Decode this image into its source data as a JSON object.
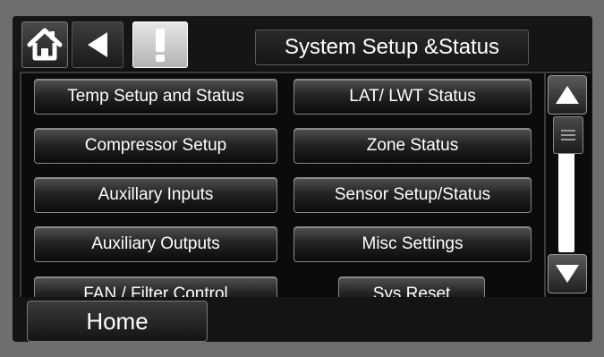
{
  "header": {
    "title": "System Setup &Status",
    "icons": [
      "home-icon",
      "back-arrow-icon",
      "alert-icon"
    ]
  },
  "menu": {
    "left": [
      "Temp Setup and Status",
      "Compressor Setup",
      "Auxillary Inputs",
      "Auxiliary Outputs",
      "FAN / Filter Control"
    ],
    "right": [
      "LAT/ LWT Status",
      "Zone Status",
      "Sensor Setup/Status",
      "Misc Settings",
      "Sys Reset"
    ]
  },
  "scrollbar": {
    "icons": [
      "up-arrow-icon",
      "down-arrow-icon"
    ]
  },
  "footer": {
    "home_label": "Home"
  },
  "colors": {
    "background": "#6e6e6e",
    "screen": "#101010",
    "alert_button": "#d0d0d0",
    "text": "#ffffff"
  }
}
